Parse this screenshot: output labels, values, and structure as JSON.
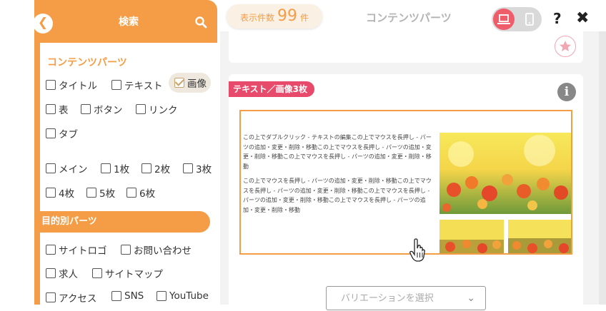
{
  "sidebar": {
    "title": "検索",
    "section_contents": "コンテンツパーツ",
    "section_purpose": "目的別パーツ",
    "content_filters": [
      {
        "label": "タイトル",
        "checked": false
      },
      {
        "label": "テキスト",
        "checked": false
      },
      {
        "label": "画像",
        "checked": true
      },
      {
        "label": "表",
        "checked": false
      },
      {
        "label": "ボタン",
        "checked": false
      },
      {
        "label": "リンク",
        "checked": false
      },
      {
        "label": "タブ",
        "checked": false
      }
    ],
    "layout_filters": [
      {
        "label": "メイン"
      },
      {
        "label": "1枚"
      },
      {
        "label": "2枚"
      },
      {
        "label": "3枚"
      },
      {
        "label": "4枚"
      },
      {
        "label": "5枚"
      },
      {
        "label": "6枚"
      }
    ],
    "purpose_filters": [
      {
        "label": "サイトロゴ"
      },
      {
        "label": "お問い合わせ"
      },
      {
        "label": "求人"
      },
      {
        "label": "サイトマップ"
      },
      {
        "label": "アクセス"
      },
      {
        "label": "SNS"
      },
      {
        "label": "YouTube"
      }
    ]
  },
  "header": {
    "count_label": "表示件数",
    "count_value": "99",
    "count_unit": "件",
    "page_title": "コンテンツパーツ",
    "help": "?",
    "close": "✖"
  },
  "card": {
    "tag": "テキスト／画像3枚",
    "info": "i",
    "paragraph1": "この上でダブルクリック - テキストの編集この上でマウスを長押し - パーツの追加・変更・削除・移動この上でマウスを長押し - パーツの追加・変更・削除・移動この上でマウスを長押し - パーツの追加・変更・削除・移動",
    "paragraph2": "この上でマウスを長押し - パーツの追加・変更・削除・移動この上でマウスを長押し - パーツの追加・変更・削除・移動この上でマウスを長押し - パーツの追加・変更・削除・移動この上でマウスを長押し - パーツの追加・変更・削除・移動",
    "variation_placeholder": "バリエーションを選択"
  },
  "colors": {
    "accent": "#f59d46",
    "tag": "#e84a6b",
    "device_active": "#ef5c6a"
  },
  "icons": {
    "back": "chevron-left-icon",
    "search": "search-icon",
    "star": "star-icon",
    "info": "info-icon",
    "pc": "laptop-icon",
    "mobile": "mobile-icon",
    "cursor": "hand-cursor-icon"
  }
}
